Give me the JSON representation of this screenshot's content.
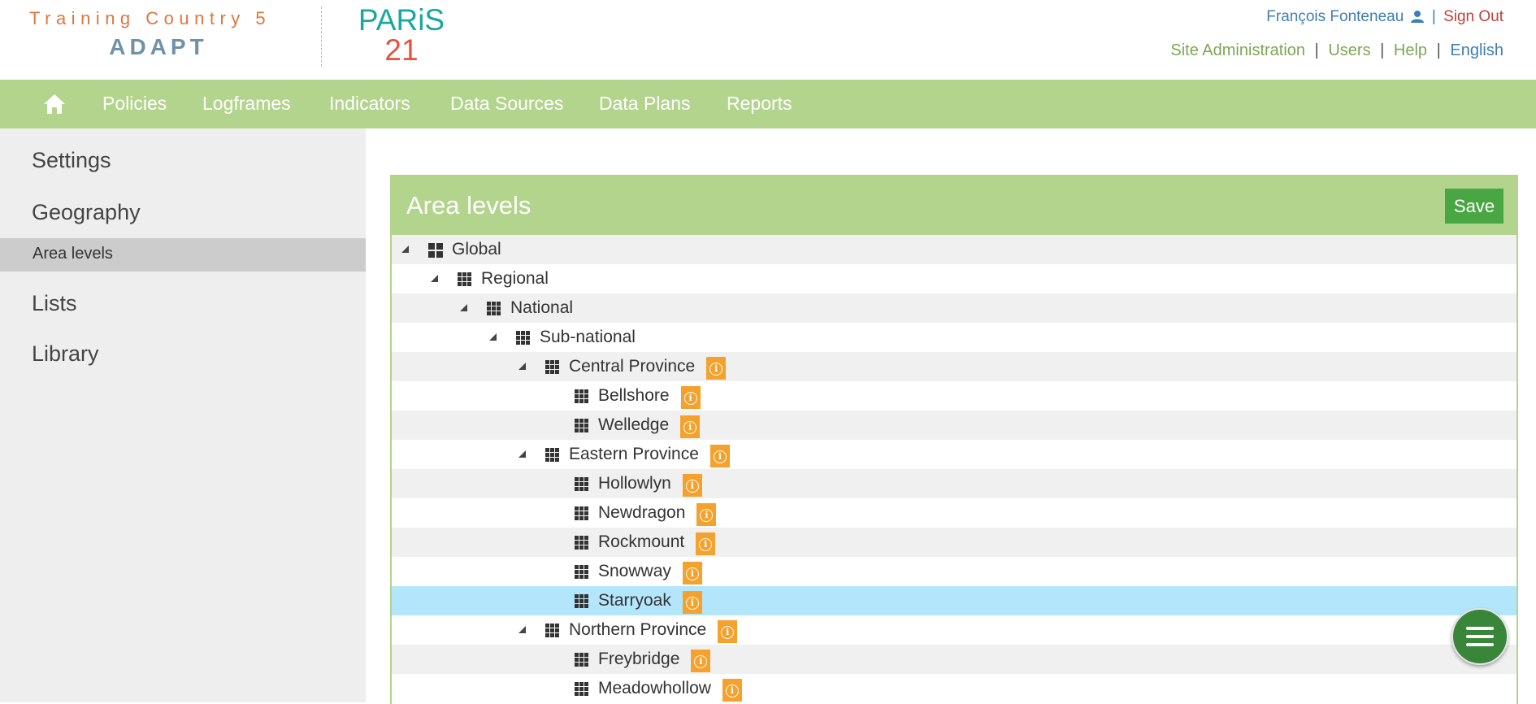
{
  "header": {
    "site_title": "Training Country 5",
    "product_name": "ADAPT",
    "partner_logo": {
      "top": "PARiS",
      "bottom": "21",
      "colors": {
        "top": "#19a89f",
        "bottom": "#e8513d"
      }
    },
    "user_name": "François Fonteneau",
    "user_icon": "user-icon",
    "separator": "|",
    "sign_out": "Sign Out",
    "links": [
      "Site Administration",
      "Users",
      "Help"
    ],
    "language": "English"
  },
  "nav": {
    "home_icon": "home-icon",
    "items": [
      "Policies",
      "Logframes",
      "Indicators",
      "Data Sources",
      "Data Plans",
      "Reports"
    ]
  },
  "sidebar": {
    "sections": [
      "Settings",
      "Geography",
      "Lists",
      "Library"
    ],
    "active_item": "Area levels"
  },
  "panel": {
    "title": "Area levels",
    "save_label": "Save",
    "info_icon": "info-icon",
    "grid_icon": "grid-icon"
  },
  "tree": {
    "rows": [
      {
        "label": "Global",
        "level": 0,
        "expandable": true,
        "info": false
      },
      {
        "label": "Regional",
        "level": 1,
        "expandable": true,
        "info": false
      },
      {
        "label": "National",
        "level": 2,
        "expandable": true,
        "info": false
      },
      {
        "label": "Sub-national",
        "level": 3,
        "expandable": true,
        "info": false
      },
      {
        "label": "Central Province",
        "level": 4,
        "expandable": true,
        "info": true
      },
      {
        "label": "Bellshore",
        "level": 5,
        "expandable": false,
        "info": true
      },
      {
        "label": "Welledge",
        "level": 5,
        "expandable": false,
        "info": true
      },
      {
        "label": "Eastern Province",
        "level": 4,
        "expandable": true,
        "info": true
      },
      {
        "label": "Hollowlyn",
        "level": 5,
        "expandable": false,
        "info": true
      },
      {
        "label": "Newdragon",
        "level": 5,
        "expandable": false,
        "info": true
      },
      {
        "label": "Rockmount",
        "level": 5,
        "expandable": false,
        "info": true
      },
      {
        "label": "Snowway",
        "level": 5,
        "expandable": false,
        "info": true
      },
      {
        "label": "Starryoak",
        "level": 5,
        "expandable": false,
        "info": true,
        "selected": true
      },
      {
        "label": "Northern Province",
        "level": 4,
        "expandable": true,
        "info": true
      },
      {
        "label": "Freybridge",
        "level": 5,
        "expandable": false,
        "info": true
      },
      {
        "label": "Meadowhollow",
        "level": 5,
        "expandable": false,
        "info": true
      }
    ]
  },
  "fab_icon": "hamburger-menu-icon",
  "colors": {
    "nav_bg": "#b3d48c",
    "save_button": "#4aa543",
    "info_icon": "#f4a22d",
    "selected_row": "#b4e6fb",
    "sign_out": "#c2403a",
    "admin_links": "#7fa654",
    "fab": "#39853a"
  }
}
